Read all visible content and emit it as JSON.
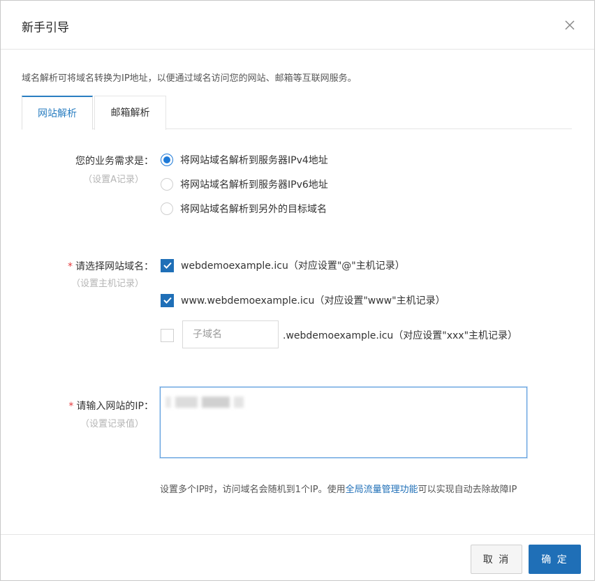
{
  "dialog": {
    "title": "新手引导",
    "description": "域名解析可将域名转换为IP地址，以便通过域名访问您的网站、邮箱等互联网服务。"
  },
  "tabs": [
    {
      "label": "网站解析",
      "active": true
    },
    {
      "label": "邮箱解析",
      "active": false
    }
  ],
  "business": {
    "label": "您的业务需求是：",
    "sublabel": "（设置A记录）",
    "options": [
      {
        "label": "将网站域名解析到服务器IPv4地址",
        "selected": true
      },
      {
        "label": "将网站域名解析到服务器IPv6地址",
        "selected": false
      },
      {
        "label": "将网站域名解析到另外的目标域名",
        "selected": false
      }
    ]
  },
  "domain": {
    "required_mark": "*",
    "label": "请选择网站域名：",
    "sublabel": "（设置主机记录）",
    "options": [
      {
        "label": "webdemoexample.icu（对应设置\"@\"主机记录）",
        "checked": true
      },
      {
        "label": "www.webdemoexample.icu（对应设置\"www\"主机记录）",
        "checked": true
      },
      {
        "label": ".webdemoexample.icu（对应设置\"xxx\"主机记录）",
        "checked": false
      }
    ],
    "subdomain_placeholder": "子域名"
  },
  "ip": {
    "required_mark": "*",
    "label": "请输入网站的IP：",
    "sublabel": "（设置记录值）",
    "hint_before": "设置多个IP时，访问域名会随机到1个IP。使用",
    "hint_link": "全局流量管理功能",
    "hint_after": "可以实现自动去除故障IP"
  },
  "footer": {
    "cancel_label": "取 消",
    "ok_label": "确 定"
  },
  "colors": {
    "accent": "#1f6fb7",
    "required": "#e4393c"
  },
  "icons": {
    "close": "close-icon",
    "check": "checkmark-icon"
  }
}
